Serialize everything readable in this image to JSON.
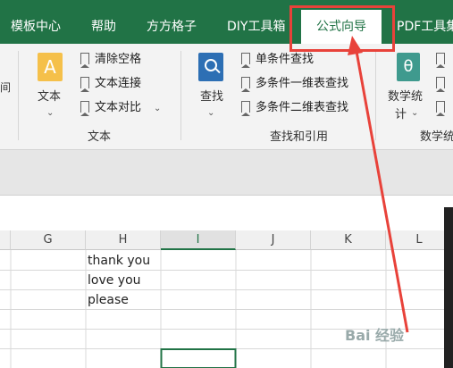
{
  "tabs": [
    {
      "label": "模板中心"
    },
    {
      "label": "帮助"
    },
    {
      "label": "方方格子"
    },
    {
      "label": "DIY工具箱"
    },
    {
      "label": "公式向导"
    },
    {
      "label": "PDF工具集"
    }
  ],
  "ribbon": {
    "text_group": {
      "big_button": "文本",
      "items": [
        "清除空格",
        "文本连接",
        "文本对比"
      ],
      "group_name": "文本"
    },
    "lookup_group": {
      "big_button": "查找",
      "items": [
        "单条件查找",
        "多条件一维表查找",
        "多条件二维表查找"
      ],
      "group_name": "查找和引用"
    },
    "math_group": {
      "big_button_line1": "数学统",
      "big_button_line2": "计",
      "group_name": "数学统"
    }
  },
  "columns": [
    "G",
    "H",
    "I",
    "J",
    "K",
    "L"
  ],
  "selected_column": "I",
  "cells": {
    "h1": "thank you",
    "h2": "love you",
    "h3": "please"
  },
  "watermark": "Bai 经验",
  "colors": {
    "excel_green": "#217346",
    "annotation_red": "#e8423a"
  }
}
